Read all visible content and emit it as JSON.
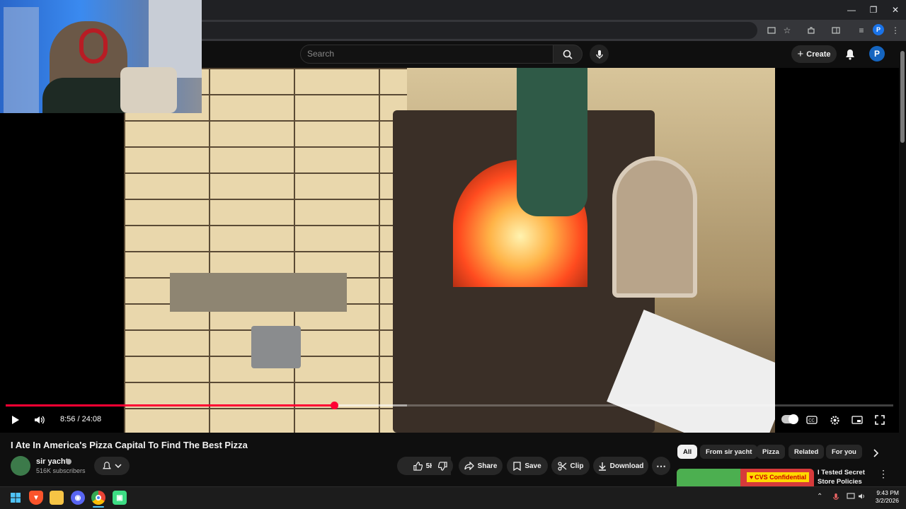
{
  "browser": {
    "window_controls": {
      "minimize": "—",
      "maximize": "❐",
      "close": "✕"
    },
    "toolbar_icons": [
      "cast-icon",
      "star-icon",
      "extensions-icon",
      "sidepanel-icon",
      "media-icon"
    ],
    "profile_letter": "P"
  },
  "youtube": {
    "search": {
      "placeholder": "Search"
    },
    "create_label": "Create",
    "avatar_letter": "P"
  },
  "player": {
    "time_display": "8:56 / 24:08",
    "progress_fraction": 0.37,
    "buffered_fraction": 0.452
  },
  "video": {
    "title": "I Ate In America's Pizza Capital To Find The Best Pizza",
    "channel": {
      "name": "sir yacht",
      "subscribers": "516K subscribers"
    },
    "actions": {
      "like_count": "5K",
      "share": "Share",
      "save": "Save",
      "clip": "Clip",
      "download": "Download"
    }
  },
  "chips": [
    "All",
    "From sir yacht",
    "Pizza",
    "Related",
    "For you"
  ],
  "recommendation": {
    "badge": "CVS Confidential",
    "title": "I Tested Secret Store Policies"
  },
  "taskbar": {
    "clock": {
      "time": "9:43 PM",
      "date": "3/2/2026"
    }
  },
  "colors": {
    "accent_red": "#ff0033",
    "background": "#0f0f0f",
    "pill": "#272727"
  }
}
